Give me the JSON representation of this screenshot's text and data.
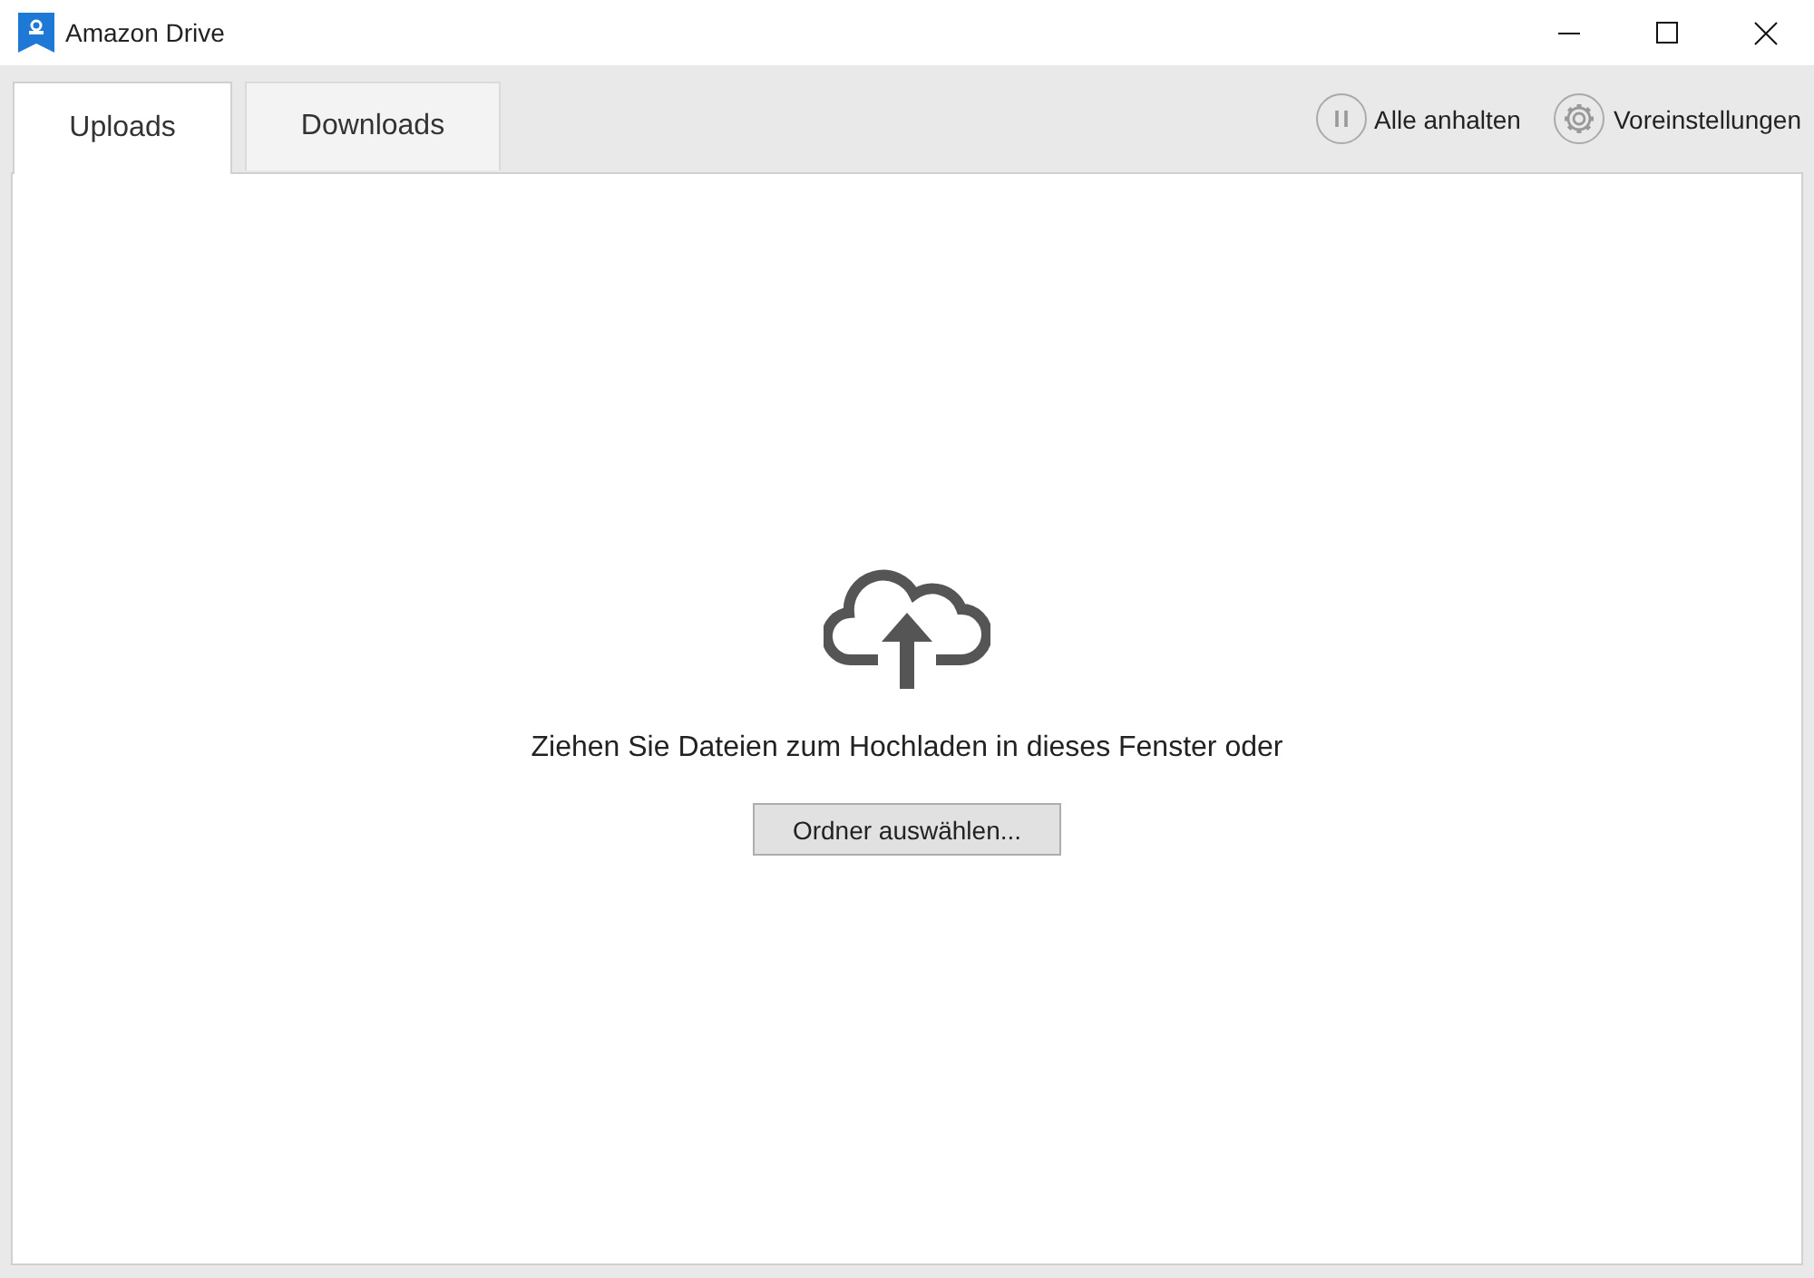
{
  "window": {
    "title": "Amazon Drive"
  },
  "tabs": [
    {
      "label": "Uploads",
      "selected": true
    },
    {
      "label": "Downloads",
      "selected": false
    }
  ],
  "toolbar_actions": [
    {
      "kind": "pause",
      "label": "Alle anhalten"
    },
    {
      "kind": "settings",
      "label": "Voreinstellungen"
    }
  ],
  "upload_area": {
    "message": "Ziehen Sie Dateien zum Hochladen in dieses Fenster oder",
    "button": "Ordner auswählen..."
  }
}
